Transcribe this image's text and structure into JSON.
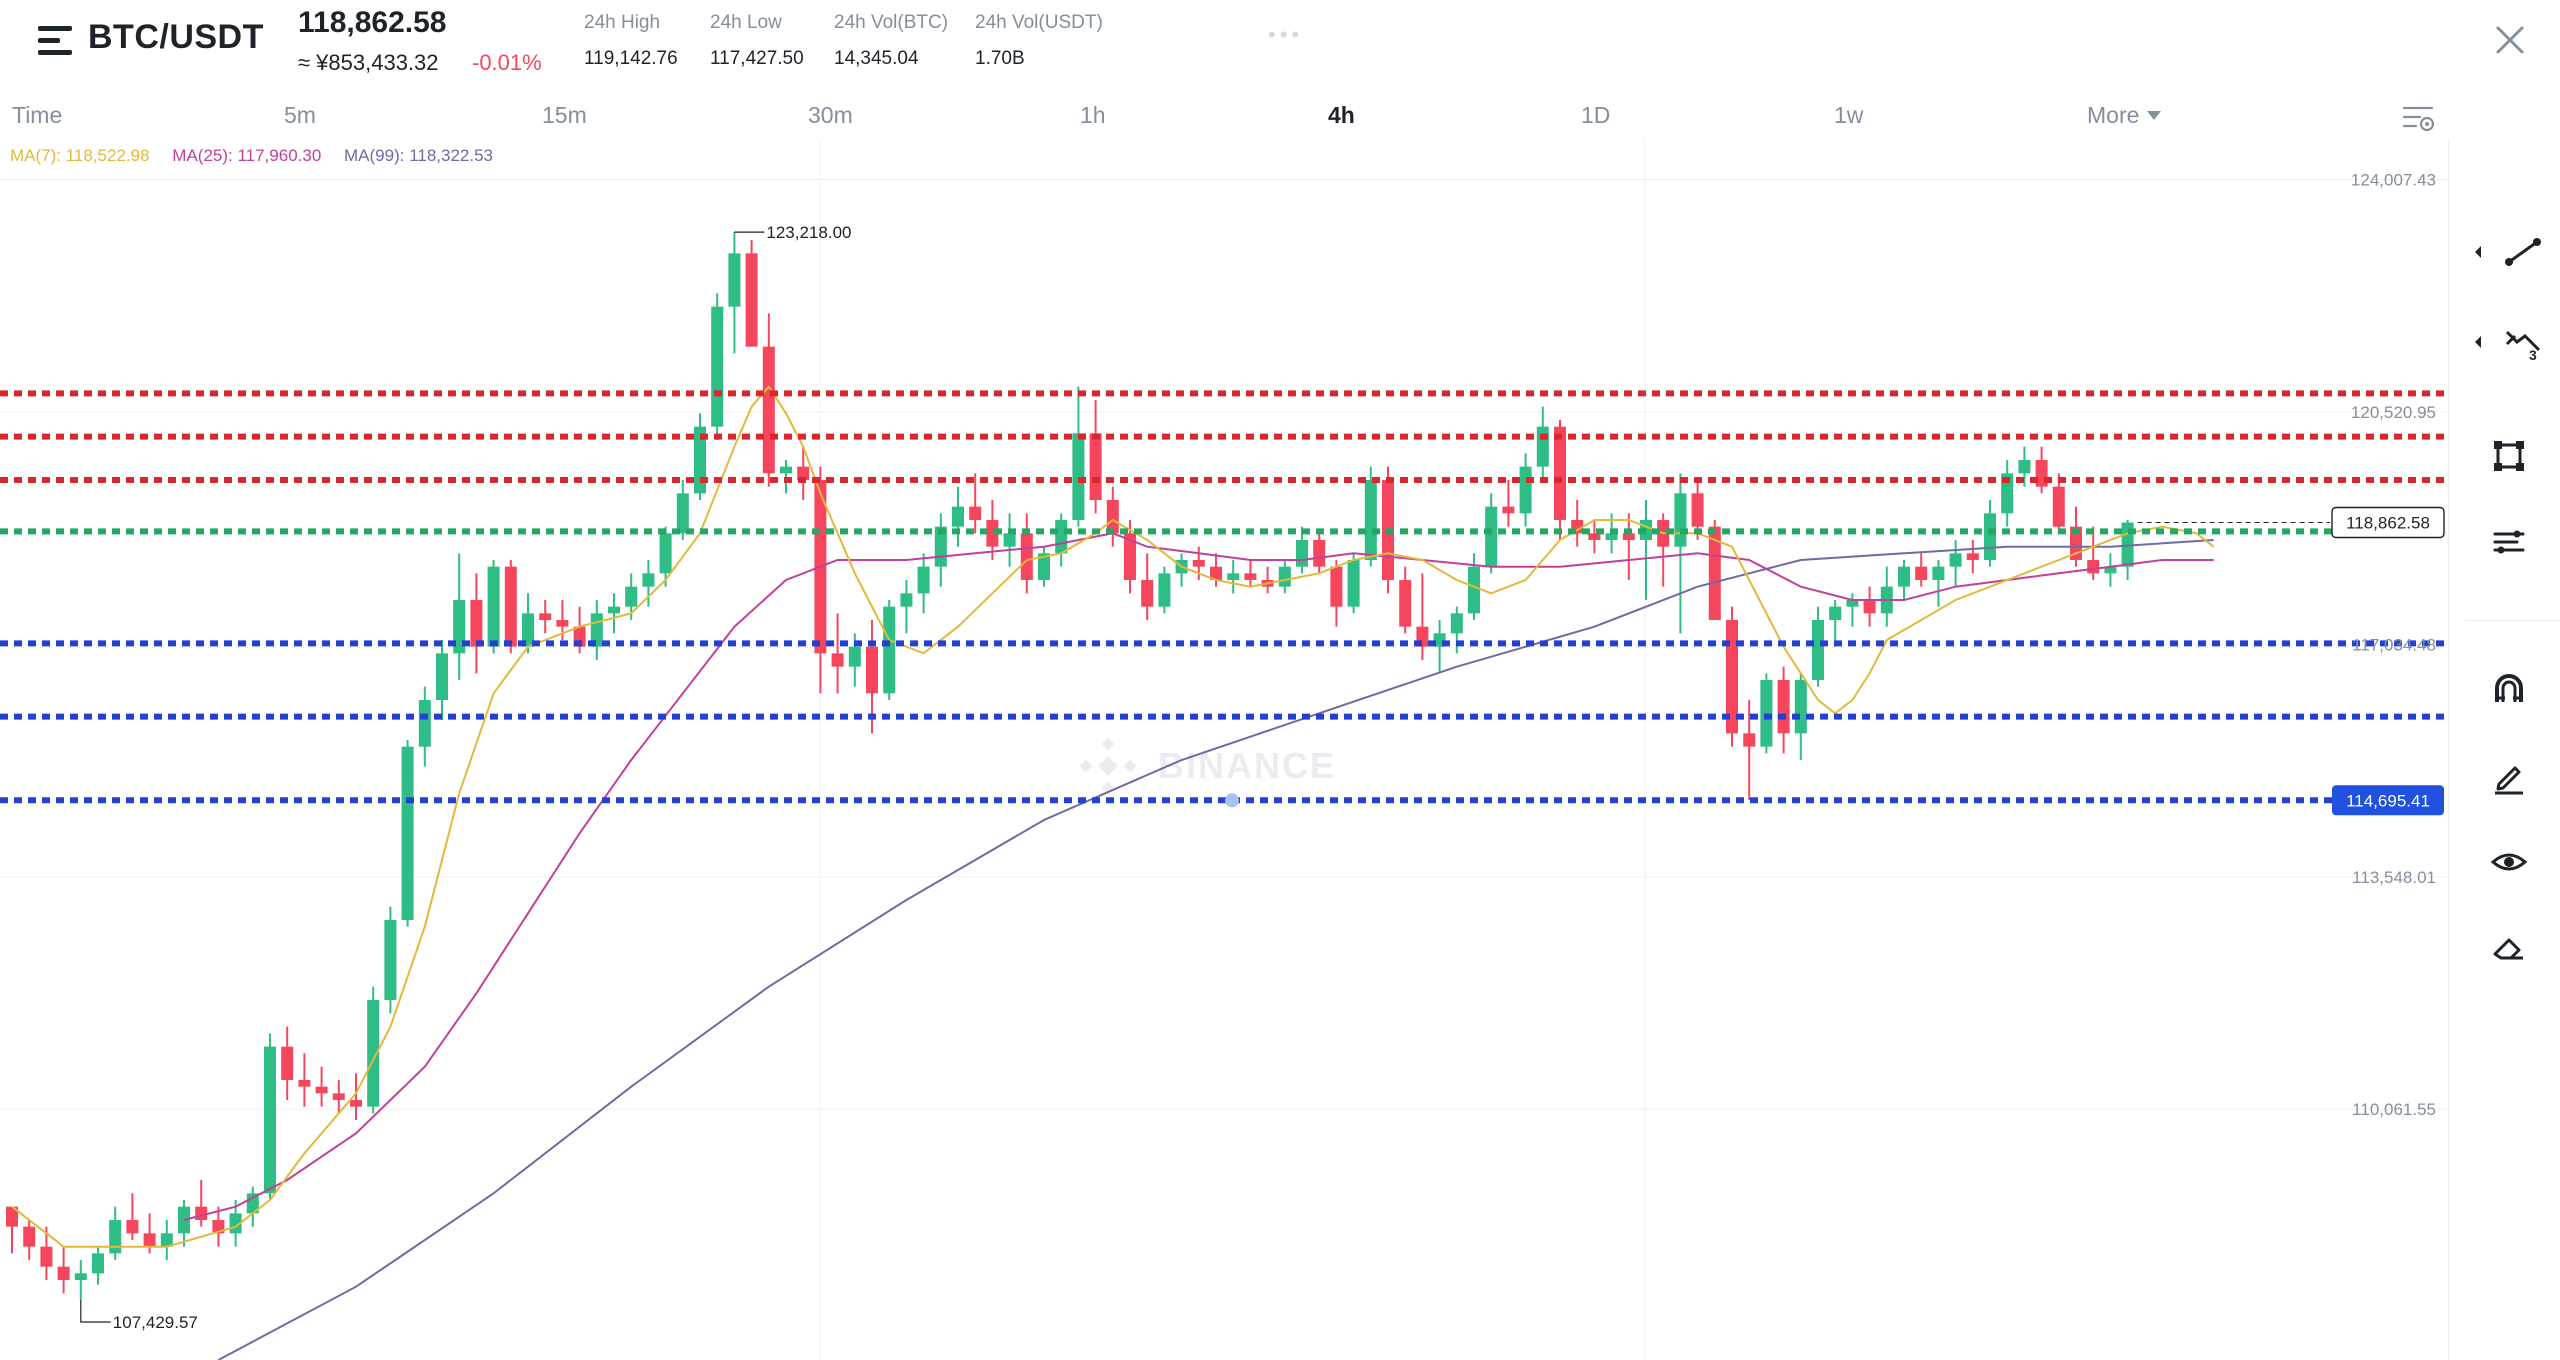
{
  "header": {
    "pair": "BTC/USDT",
    "last_price": "118,862.58",
    "cny_price": "≈ ¥853,433.32",
    "change_pct": "-0.01%",
    "stats": [
      {
        "label": "24h High",
        "value": "119,142.76"
      },
      {
        "label": "24h Low",
        "value": "117,427.50"
      },
      {
        "label": "24h Vol(BTC)",
        "value": "14,345.04"
      },
      {
        "label": "24h Vol(USDT)",
        "value": "1.70B"
      }
    ],
    "more_dots": "•••"
  },
  "tabs": {
    "items": [
      "Time",
      "5m",
      "15m",
      "30m",
      "1h",
      "4h",
      "1D",
      "1w"
    ],
    "active": "4h",
    "more": "More"
  },
  "ma_legend": {
    "ma7": "MA(7): 118,522.98",
    "ma25": "MA(25): 117,960.30",
    "ma99": "MA(99): 118,322.53"
  },
  "chart_data": {
    "type": "candlestick",
    "pair": "BTC/USDT",
    "interval": "4h",
    "watermark": "BINANCE",
    "ylim": [
      106300,
      124600
    ],
    "price_ticks": [
      "124,007.43",
      "120,520.95",
      "117,034.48",
      "113,548.01",
      "110,061.55"
    ],
    "price_tick_values": [
      124007.43,
      120520.95,
      117034.48,
      113548.01,
      110061.55
    ],
    "last_price_label": "118,862.58",
    "last_price": 118862.58,
    "level_label": "114,695.41",
    "max_label": "123,218.00",
    "min_label": "107,429.57",
    "colors": {
      "up": "#2ebd85",
      "down": "#f6465d",
      "ma7": "#e2b93b",
      "ma25": "#c2409c",
      "ma99": "#6e6aa4",
      "res": "#d9272e",
      "curr": "#24a665",
      "sup": "#2241d4",
      "level_tag": "#2051e0"
    },
    "resistance_levels": [
      120800,
      120150,
      119500
    ],
    "current_level": 118730,
    "support_levels": [
      117050,
      115950,
      114695.41
    ],
    "candles": [
      [
        108600,
        108600,
        107900,
        108300
      ],
      [
        108300,
        108400,
        107800,
        108000
      ],
      [
        108000,
        108300,
        107500,
        107700
      ],
      [
        107700,
        108000,
        107300,
        107500
      ],
      [
        107500,
        107800,
        107200,
        107600
      ],
      [
        107600,
        108000,
        107430,
        107900
      ],
      [
        107900,
        108600,
        107800,
        108400
      ],
      [
        108400,
        108800,
        108100,
        108200
      ],
      [
        108200,
        108500,
        107900,
        108000
      ],
      [
        108000,
        108400,
        107800,
        108200
      ],
      [
        108200,
        108700,
        108000,
        108600
      ],
      [
        108600,
        109000,
        108300,
        108400
      ],
      [
        108400,
        108600,
        108000,
        108200
      ],
      [
        108200,
        108700,
        108000,
        108500
      ],
      [
        108500,
        108900,
        108300,
        108800
      ],
      [
        108800,
        111200,
        108700,
        111000
      ],
      [
        111000,
        111300,
        110200,
        110500
      ],
      [
        110500,
        110900,
        110100,
        110400
      ],
      [
        110400,
        110700,
        110100,
        110300
      ],
      [
        110300,
        110500,
        110000,
        110200
      ],
      [
        110200,
        110600,
        109900,
        110100
      ],
      [
        110100,
        111900,
        110000,
        111700
      ],
      [
        111700,
        113100,
        111500,
        112900
      ],
      [
        112900,
        115600,
        112800,
        115500
      ],
      [
        115500,
        116400,
        115200,
        116200
      ],
      [
        116200,
        117100,
        115900,
        116900
      ],
      [
        116900,
        118400,
        116500,
        117700
      ],
      [
        117700,
        118100,
        116600,
        117000
      ],
      [
        117000,
        118300,
        116900,
        118200
      ],
      [
        118200,
        118300,
        116900,
        117000
      ],
      [
        117000,
        117800,
        116900,
        117500
      ],
      [
        117500,
        117700,
        117200,
        117400
      ],
      [
        117400,
        117700,
        117100,
        117300
      ],
      [
        117300,
        117600,
        116900,
        117000
      ],
      [
        117000,
        117700,
        116800,
        117500
      ],
      [
        117500,
        117800,
        117200,
        117600
      ],
      [
        117600,
        118100,
        117400,
        117900
      ],
      [
        117900,
        118300,
        117600,
        118100
      ],
      [
        118100,
        118800,
        117900,
        118700
      ],
      [
        118700,
        119500,
        118600,
        119300
      ],
      [
        119300,
        120500,
        119200,
        120300
      ],
      [
        120300,
        122300,
        120100,
        122100
      ],
      [
        122100,
        123218,
        121400,
        122900
      ],
      [
        122900,
        123100,
        121700,
        121500
      ],
      [
        121500,
        122000,
        119400,
        119600
      ],
      [
        119600,
        119800,
        119300,
        119700
      ],
      [
        119700,
        120000,
        119200,
        119500
      ],
      [
        119500,
        119700,
        116300,
        116900
      ],
      [
        116900,
        117500,
        116300,
        116700
      ],
      [
        116700,
        117200,
        116400,
        117000
      ],
      [
        117000,
        117400,
        115700,
        116300
      ],
      [
        116300,
        117700,
        116200,
        117600
      ],
      [
        117600,
        118000,
        117200,
        117800
      ],
      [
        117800,
        118400,
        117500,
        118200
      ],
      [
        118200,
        119000,
        117900,
        118800
      ],
      [
        118800,
        119400,
        118500,
        119100
      ],
      [
        119100,
        119600,
        118700,
        118900
      ],
      [
        118900,
        119200,
        118300,
        118500
      ],
      [
        118500,
        119000,
        118200,
        118700
      ],
      [
        118700,
        119000,
        117800,
        118000
      ],
      [
        118000,
        118500,
        117900,
        118400
      ],
      [
        118400,
        119000,
        118200,
        118900
      ],
      [
        118900,
        120900,
        118800,
        120200
      ],
      [
        120200,
        120700,
        119000,
        119200
      ],
      [
        119200,
        119400,
        118500,
        118700
      ],
      [
        118700,
        118900,
        117800,
        118000
      ],
      [
        118000,
        118400,
        117400,
        117600
      ],
      [
        117600,
        118200,
        117500,
        118100
      ],
      [
        118100,
        118400,
        117900,
        118300
      ],
      [
        118300,
        118500,
        118000,
        118200
      ],
      [
        118200,
        118400,
        117900,
        118000
      ],
      [
        118000,
        118300,
        117800,
        118100
      ],
      [
        118100,
        118300,
        117900,
        118000
      ],
      [
        118000,
        118200,
        117800,
        117900
      ],
      [
        117900,
        118300,
        117800,
        118200
      ],
      [
        118200,
        118800,
        118100,
        118600
      ],
      [
        118600,
        118700,
        118100,
        118200
      ],
      [
        118200,
        118300,
        117300,
        117600
      ],
      [
        117600,
        118400,
        117500,
        118300
      ],
      [
        118300,
        119700,
        118200,
        119500
      ],
      [
        119500,
        119700,
        117800,
        118000
      ],
      [
        118000,
        118200,
        117200,
        117300
      ],
      [
        117300,
        118100,
        116800,
        117000
      ],
      [
        117000,
        117400,
        116600,
        117200
      ],
      [
        117200,
        117600,
        116900,
        117500
      ],
      [
        117500,
        118400,
        117400,
        118200
      ],
      [
        118200,
        119300,
        118100,
        119100
      ],
      [
        119100,
        119500,
        118800,
        119000
      ],
      [
        119000,
        119900,
        118800,
        119700
      ],
      [
        119700,
        120600,
        119500,
        120300
      ],
      [
        120300,
        120400,
        118600,
        118900
      ],
      [
        118900,
        119200,
        118500,
        118700
      ],
      [
        118700,
        118900,
        118400,
        118600
      ],
      [
        118600,
        119000,
        118400,
        118700
      ],
      [
        118700,
        119000,
        118000,
        118600
      ],
      [
        118600,
        119200,
        117700,
        118900
      ],
      [
        118900,
        119000,
        117900,
        118500
      ],
      [
        118500,
        119600,
        117200,
        119300
      ],
      [
        119300,
        119500,
        118600,
        118800
      ],
      [
        118800,
        118900,
        117500,
        117400
      ],
      [
        117400,
        117600,
        115500,
        115700
      ],
      [
        115700,
        116200,
        114700,
        115500
      ],
      [
        115500,
        116600,
        115400,
        116500
      ],
      [
        116500,
        116700,
        115400,
        115700
      ],
      [
        115700,
        116600,
        115300,
        116500
      ],
      [
        116500,
        117600,
        116400,
        117400
      ],
      [
        117400,
        117700,
        117000,
        117600
      ],
      [
        117600,
        117800,
        117300,
        117700
      ],
      [
        117700,
        117900,
        117300,
        117500
      ],
      [
        117500,
        118200,
        117300,
        117900
      ],
      [
        117900,
        118300,
        117700,
        118200
      ],
      [
        118200,
        118400,
        117900,
        118000
      ],
      [
        118000,
        118300,
        117600,
        118200
      ],
      [
        118200,
        118600,
        117900,
        118400
      ],
      [
        118400,
        118600,
        118100,
        118300
      ],
      [
        118300,
        119200,
        118200,
        119000
      ],
      [
        119000,
        119800,
        118800,
        119600
      ],
      [
        119600,
        120000,
        119400,
        119800
      ],
      [
        119800,
        120000,
        119300,
        119400
      ],
      [
        119400,
        119600,
        118700,
        118800
      ],
      [
        118800,
        119100,
        118200,
        118300
      ],
      [
        118300,
        118800,
        118000,
        118100
      ],
      [
        118100,
        118400,
        117900,
        118200
      ],
      [
        118200,
        118900,
        118000,
        118863
      ]
    ],
    "ma7": [
      [
        0,
        108600
      ],
      [
        3,
        108000
      ],
      [
        6,
        108000
      ],
      [
        9,
        108000
      ],
      [
        13,
        108300
      ],
      [
        15,
        108700
      ],
      [
        17,
        109400
      ],
      [
        20,
        110300
      ],
      [
        22,
        111300
      ],
      [
        24,
        112800
      ],
      [
        26,
        114800
      ],
      [
        28,
        116300
      ],
      [
        30,
        117000
      ],
      [
        33,
        117300
      ],
      [
        36,
        117500
      ],
      [
        38,
        118000
      ],
      [
        40,
        118700
      ],
      [
        42,
        120000
      ],
      [
        43,
        120600
      ],
      [
        44,
        120900
      ],
      [
        45,
        120500
      ],
      [
        46,
        120000
      ],
      [
        47,
        119300
      ],
      [
        49,
        118100
      ],
      [
        51,
        117100
      ],
      [
        53,
        116900
      ],
      [
        55,
        117300
      ],
      [
        57,
        117800
      ],
      [
        59,
        118300
      ],
      [
        61,
        118400
      ],
      [
        63,
        118700
      ],
      [
        64,
        118900
      ],
      [
        66,
        118600
      ],
      [
        68,
        118200
      ],
      [
        70,
        118000
      ],
      [
        72,
        117900
      ],
      [
        74,
        118000
      ],
      [
        76,
        118100
      ],
      [
        78,
        118300
      ],
      [
        80,
        118400
      ],
      [
        82,
        118300
      ],
      [
        84,
        118000
      ],
      [
        86,
        117800
      ],
      [
        88,
        118000
      ],
      [
        90,
        118600
      ],
      [
        92,
        118900
      ],
      [
        94,
        118900
      ],
      [
        96,
        118700
      ],
      [
        98,
        118700
      ],
      [
        100,
        118500
      ],
      [
        101,
        118000
      ],
      [
        103,
        117000
      ],
      [
        105,
        116200
      ],
      [
        106,
        116000
      ],
      [
        107,
        116200
      ],
      [
        108,
        116600
      ],
      [
        109,
        117100
      ],
      [
        111,
        117400
      ],
      [
        113,
        117700
      ],
      [
        115,
        117900
      ],
      [
        117,
        118100
      ],
      [
        119,
        118300
      ],
      [
        121,
        118500
      ],
      [
        123,
        118700
      ],
      [
        125,
        118800
      ],
      [
        127,
        118700
      ],
      [
        128,
        118500
      ]
    ],
    "ma25": [
      [
        10,
        108400
      ],
      [
        13,
        108600
      ],
      [
        16,
        109000
      ],
      [
        20,
        109700
      ],
      [
        24,
        110700
      ],
      [
        27,
        111800
      ],
      [
        30,
        113000
      ],
      [
        33,
        114200
      ],
      [
        36,
        115300
      ],
      [
        39,
        116300
      ],
      [
        42,
        117300
      ],
      [
        45,
        118000
      ],
      [
        48,
        118300
      ],
      [
        52,
        118300
      ],
      [
        56,
        118400
      ],
      [
        60,
        118500
      ],
      [
        62,
        118600
      ],
      [
        64,
        118700
      ],
      [
        66,
        118500
      ],
      [
        69,
        118400
      ],
      [
        72,
        118300
      ],
      [
        75,
        118300
      ],
      [
        78,
        118400
      ],
      [
        82,
        118300
      ],
      [
        86,
        118200
      ],
      [
        90,
        118200
      ],
      [
        94,
        118300
      ],
      [
        98,
        118400
      ],
      [
        101,
        118300
      ],
      [
        104,
        117900
      ],
      [
        107,
        117700
      ],
      [
        110,
        117700
      ],
      [
        113,
        117900
      ],
      [
        116,
        118000
      ],
      [
        119,
        118100
      ],
      [
        122,
        118200
      ],
      [
        125,
        118300
      ],
      [
        128,
        118300
      ]
    ],
    "ma99": [
      [
        12,
        106300
      ],
      [
        20,
        107400
      ],
      [
        28,
        108800
      ],
      [
        36,
        110400
      ],
      [
        44,
        111900
      ],
      [
        52,
        113200
      ],
      [
        60,
        114400
      ],
      [
        68,
        115300
      ],
      [
        76,
        116000
      ],
      [
        84,
        116700
      ],
      [
        92,
        117300
      ],
      [
        98,
        117900
      ],
      [
        104,
        118300
      ],
      [
        110,
        118400
      ],
      [
        116,
        118500
      ],
      [
        122,
        118500
      ],
      [
        128,
        118600
      ]
    ]
  },
  "toolbar": {
    "tools": [
      "trendline-tool",
      "fib-tool",
      "shape-tool",
      "indicator-tool",
      "magnet-tool",
      "pen-tool",
      "visibility-tool",
      "eraser-tool"
    ]
  }
}
